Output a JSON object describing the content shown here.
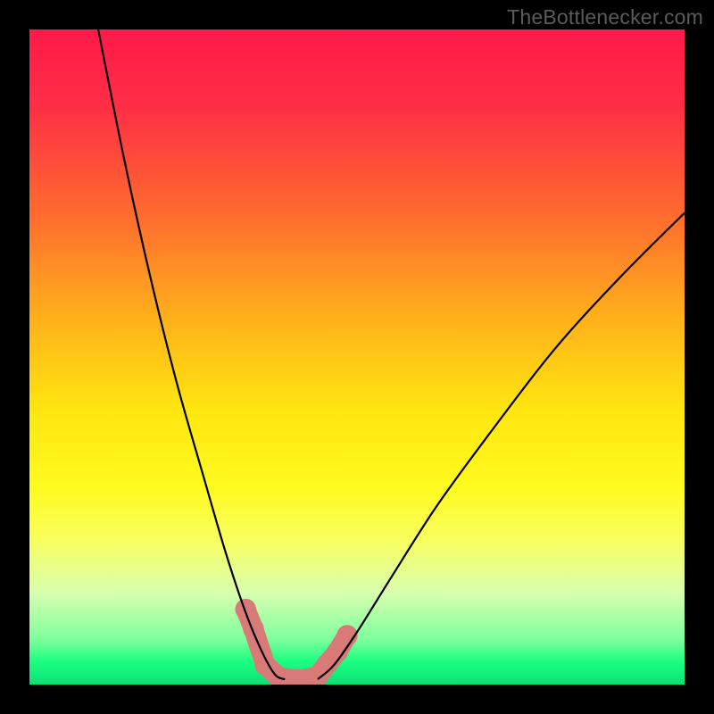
{
  "watermark": "TheBottlenecker.com",
  "chart_data": {
    "type": "line",
    "title": "",
    "xlabel": "",
    "ylabel": "",
    "xlim": [
      0,
      100
    ],
    "ylim": [
      0,
      100
    ],
    "gradient_stops": [
      {
        "offset": 0.0,
        "color": "#ff1a4a"
      },
      {
        "offset": 0.12,
        "color": "#ff2f45"
      },
      {
        "offset": 0.28,
        "color": "#ff6a2f"
      },
      {
        "offset": 0.45,
        "color": "#ffb41a"
      },
      {
        "offset": 0.58,
        "color": "#ffe610"
      },
      {
        "offset": 0.7,
        "color": "#fffb20"
      },
      {
        "offset": 0.78,
        "color": "#f8ff60"
      },
      {
        "offset": 0.86,
        "color": "#d8ffb0"
      },
      {
        "offset": 0.93,
        "color": "#80ff9e"
      },
      {
        "offset": 0.965,
        "color": "#1bff80"
      },
      {
        "offset": 1.0,
        "color": "#0be077"
      }
    ],
    "curve_left": [
      {
        "x": 10.5,
        "y": 100
      },
      {
        "x": 14.5,
        "y": 80
      },
      {
        "x": 18.5,
        "y": 62
      },
      {
        "x": 22.5,
        "y": 46
      },
      {
        "x": 26.5,
        "y": 32
      },
      {
        "x": 30.0,
        "y": 20
      },
      {
        "x": 33.0,
        "y": 11
      },
      {
        "x": 35.5,
        "y": 5
      },
      {
        "x": 37.5,
        "y": 1.5
      },
      {
        "x": 39.0,
        "y": 0.8
      }
    ],
    "curve_right": [
      {
        "x": 44.0,
        "y": 0.8
      },
      {
        "x": 46.5,
        "y": 3
      },
      {
        "x": 50.0,
        "y": 8
      },
      {
        "x": 55.0,
        "y": 16
      },
      {
        "x": 62.0,
        "y": 27
      },
      {
        "x": 70.0,
        "y": 38
      },
      {
        "x": 80.0,
        "y": 51
      },
      {
        "x": 90.0,
        "y": 62
      },
      {
        "x": 100.0,
        "y": 72
      }
    ],
    "marker_band": {
      "points": [
        {
          "x": 33.0,
          "y": 11.5
        },
        {
          "x": 34.2,
          "y": 8.5
        },
        {
          "x": 36.0,
          "y": 3.0
        },
        {
          "x": 38.0,
          "y": 1.2
        },
        {
          "x": 40.0,
          "y": 0.8
        },
        {
          "x": 42.0,
          "y": 0.8
        },
        {
          "x": 44.0,
          "y": 1.3
        },
        {
          "x": 45.5,
          "y": 3.2
        },
        {
          "x": 47.0,
          "y": 5.0
        },
        {
          "x": 48.5,
          "y": 7.5
        }
      ],
      "color": "#d87a78",
      "radius_norm": 1.6
    }
  }
}
